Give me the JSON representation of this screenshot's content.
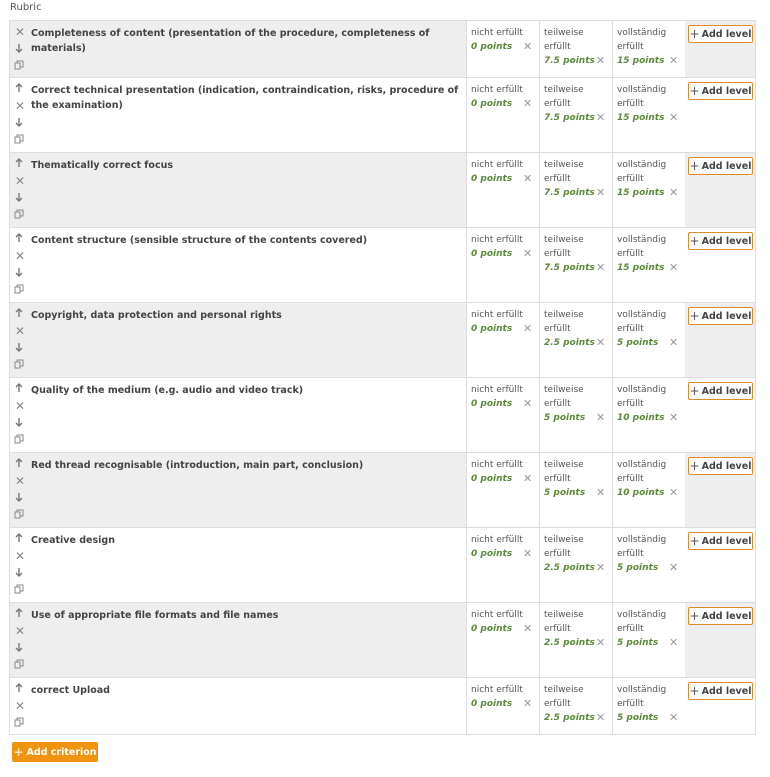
{
  "page": {
    "title": "Rubric"
  },
  "labels": {
    "add_level": "Add level",
    "add_criterion": "Add criterion",
    "level_not": "nicht erfüllt",
    "level_partial": "teilweise erfüllt",
    "level_full": "vollständig erfüllt"
  },
  "icons": {
    "move_up": "arrow-up-icon",
    "move_down": "arrow-down-icon",
    "delete": "close-icon",
    "duplicate": "duplicate-icon",
    "add": "plus-icon"
  },
  "colors": {
    "points": "#5d8a3a",
    "accent": "#f0940f",
    "add_level_border": "#e0892b",
    "alt_row": "#eeeeee"
  },
  "criteria": [
    {
      "description": "Completeness of content (presentation of the procedure, completeness of materials)",
      "levels": [
        {
          "name": "nicht erfüllt",
          "points": "0 points"
        },
        {
          "name": "teilweise erfüllt",
          "points": "7.5 points"
        },
        {
          "name": "vollständig erfüllt",
          "points": "15 points"
        }
      ]
    },
    {
      "description": "Correct technical presentation (indication, contraindication, risks, procedure of the examination)",
      "levels": [
        {
          "name": "nicht erfüllt",
          "points": "0 points"
        },
        {
          "name": "teilweise erfüllt",
          "points": "7.5 points"
        },
        {
          "name": "vollständig erfüllt",
          "points": "15 points"
        }
      ]
    },
    {
      "description": "Thematically correct focus",
      "levels": [
        {
          "name": "nicht erfüllt",
          "points": "0 points"
        },
        {
          "name": "teilweise erfüllt",
          "points": "7.5 points"
        },
        {
          "name": "vollständig erfüllt",
          "points": "15 points"
        }
      ]
    },
    {
      "description": "Content structure (sensible structure of the contents covered)",
      "levels": [
        {
          "name": "nicht erfüllt",
          "points": "0 points"
        },
        {
          "name": "teilweise erfüllt",
          "points": "7.5 points"
        },
        {
          "name": "vollständig erfüllt",
          "points": "15 points"
        }
      ]
    },
    {
      "description": "Copyright, data protection and personal rights",
      "levels": [
        {
          "name": "nicht erfüllt",
          "points": "0 points"
        },
        {
          "name": "teilweise erfüllt",
          "points": "2.5 points"
        },
        {
          "name": "vollständig erfüllt",
          "points": "5 points"
        }
      ]
    },
    {
      "description": "Quality of the medium (e.g. audio and video track)",
      "levels": [
        {
          "name": "nicht erfüllt",
          "points": "0 points"
        },
        {
          "name": "teilweise erfüllt",
          "points": "5 points"
        },
        {
          "name": "vollständig erfüllt",
          "points": "10 points"
        }
      ]
    },
    {
      "description": "Red thread recognisable (introduction, main part, conclusion)",
      "levels": [
        {
          "name": "nicht erfüllt",
          "points": "0 points"
        },
        {
          "name": "teilweise erfüllt",
          "points": "5 points"
        },
        {
          "name": "vollständig erfüllt",
          "points": "10 points"
        }
      ]
    },
    {
      "description": "Creative design",
      "levels": [
        {
          "name": "nicht erfüllt",
          "points": "0 points"
        },
        {
          "name": "teilweise erfüllt",
          "points": "2.5 points"
        },
        {
          "name": "vollständig erfüllt",
          "points": "5 points"
        }
      ]
    },
    {
      "description": "Use of appropriate file formats and file names",
      "levels": [
        {
          "name": "nicht erfüllt",
          "points": "0 points"
        },
        {
          "name": "teilweise erfüllt",
          "points": "2.5 points"
        },
        {
          "name": "vollständig erfüllt",
          "points": "5 points"
        }
      ]
    },
    {
      "description": "correct Upload",
      "levels": [
        {
          "name": "nicht erfüllt",
          "points": "0 points"
        },
        {
          "name": "teilweise erfüllt",
          "points": "2.5 points"
        },
        {
          "name": "vollständig erfüllt",
          "points": "5 points"
        }
      ]
    }
  ]
}
